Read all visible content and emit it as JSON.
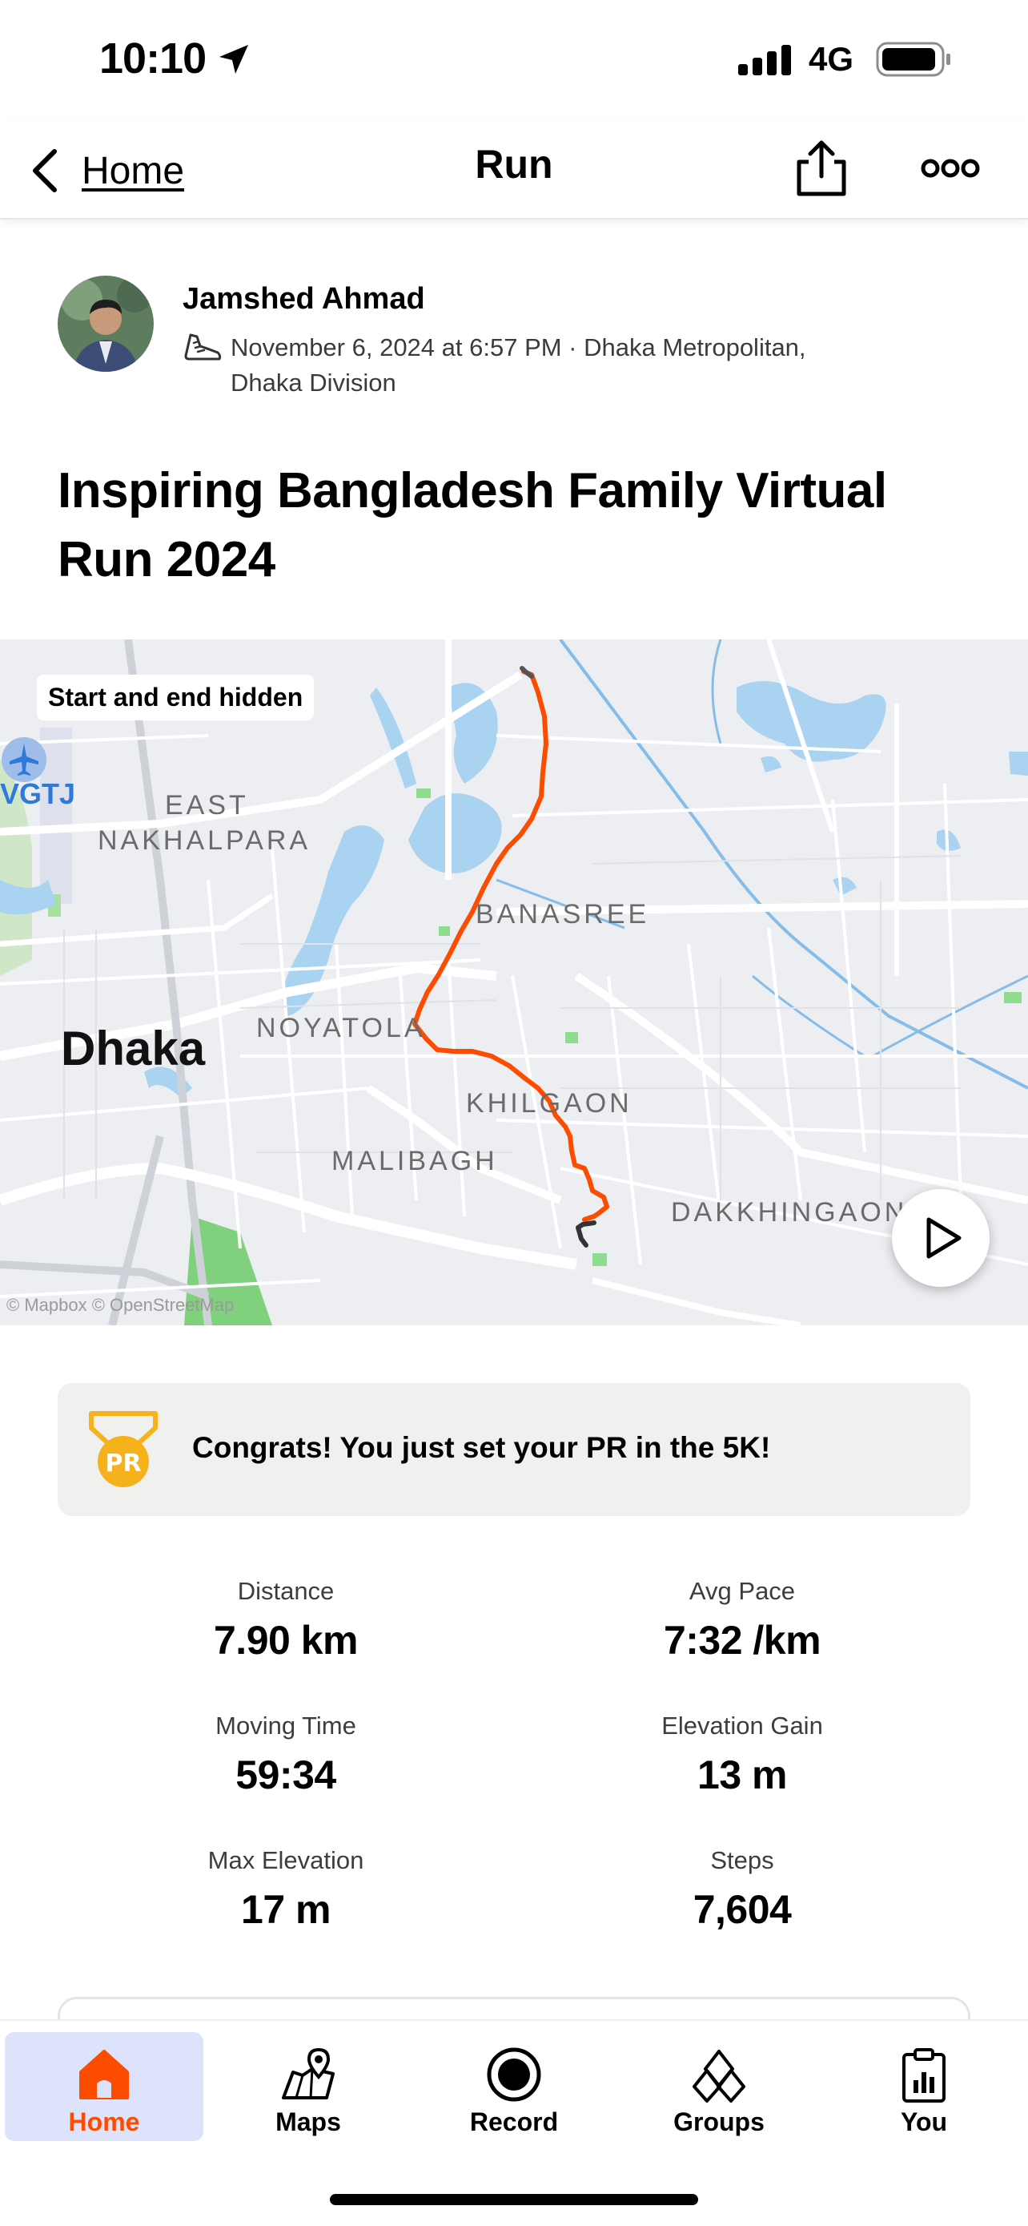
{
  "status_bar": {
    "time": "10:10",
    "network": "4G"
  },
  "nav": {
    "back_label": "Home",
    "title": "Run"
  },
  "athlete": {
    "name": "Jamshed Ahmad",
    "meta_line1": "November 6, 2024 at 6:57 PM · Dhaka Metropolitan,",
    "meta_line2": "Dhaka Division"
  },
  "activity": {
    "title": "Inspiring Bangladesh Family Virtual Run 2024"
  },
  "map": {
    "badge": "Start and end hidden",
    "city": "Dhaka",
    "airport_code": "VGTJ",
    "attribution": "© Mapbox © OpenStreetMap",
    "labels": {
      "east_line1": "EAST",
      "east_line2": "NAKHALPARA",
      "banasree": "BANASREE",
      "noyatola": "NOYATOLA",
      "khilgaon": "KHILGAON",
      "malibagh": "MALIBAGH",
      "dakkhingaon": "DAKKHINGAON"
    },
    "route_color": "#fc4c02"
  },
  "pr": {
    "medal_text": "PR",
    "message": "Congrats! You just set your PR in the 5K!"
  },
  "stats": [
    {
      "label": "Distance",
      "value": "7.90 km"
    },
    {
      "label": "Avg Pace",
      "value": "7:32 /km"
    },
    {
      "label": "Moving Time",
      "value": "59:34"
    },
    {
      "label": "Elevation Gain",
      "value": "13 m"
    },
    {
      "label": "Max Elevation",
      "value": "17 m"
    },
    {
      "label": "Steps",
      "value": "7,604"
    }
  ],
  "tabs": [
    {
      "label": "Home",
      "icon": "home-icon",
      "active": true
    },
    {
      "label": "Maps",
      "icon": "map-icon",
      "active": false
    },
    {
      "label": "Record",
      "icon": "record-icon",
      "active": false
    },
    {
      "label": "Groups",
      "icon": "groups-icon",
      "active": false
    },
    {
      "label": "You",
      "icon": "clipboard-icon",
      "active": false
    }
  ],
  "colors": {
    "accent": "#fc4c02",
    "active_tab_bg": "#dde3fb",
    "pr_gold": "#f5b21b"
  }
}
